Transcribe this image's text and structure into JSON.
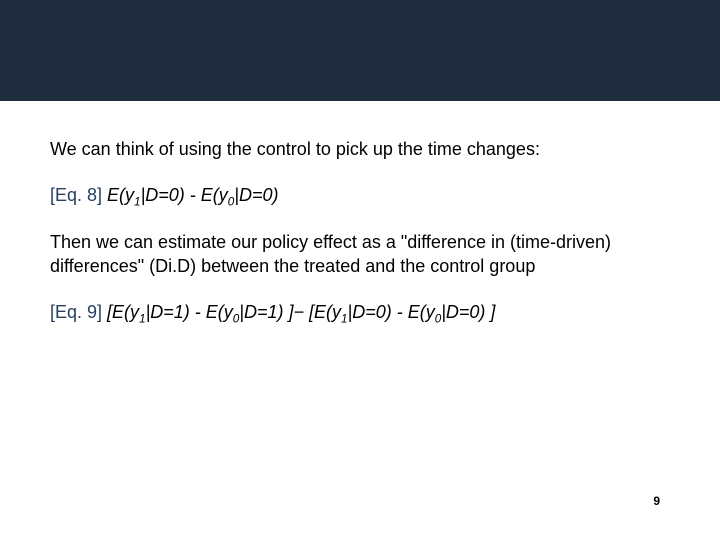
{
  "p1": "We can think of using the control to pick up the time changes:",
  "eq8_label": "[Eq. 8]",
  "eq8_a": "E(y",
  "eq8_b": "|D=0) - E(y",
  "eq8_c": "|D=0)",
  "sub1": "1",
  "sub0": "0",
  "p2": "Then we can estimate our policy effect as a \"difference in (time-driven) differences\" (Di.D) between the treated and the control group",
  "eq9_label": "[Eq. 9]",
  "eq9_a": "[E(y",
  "eq9_b": "|D=1) - E(y",
  "eq9_c": "|D=1) ]− [E(y",
  "eq9_d": "|D=0) - E(y",
  "eq9_e": "|D=0) ]",
  "page": "9"
}
